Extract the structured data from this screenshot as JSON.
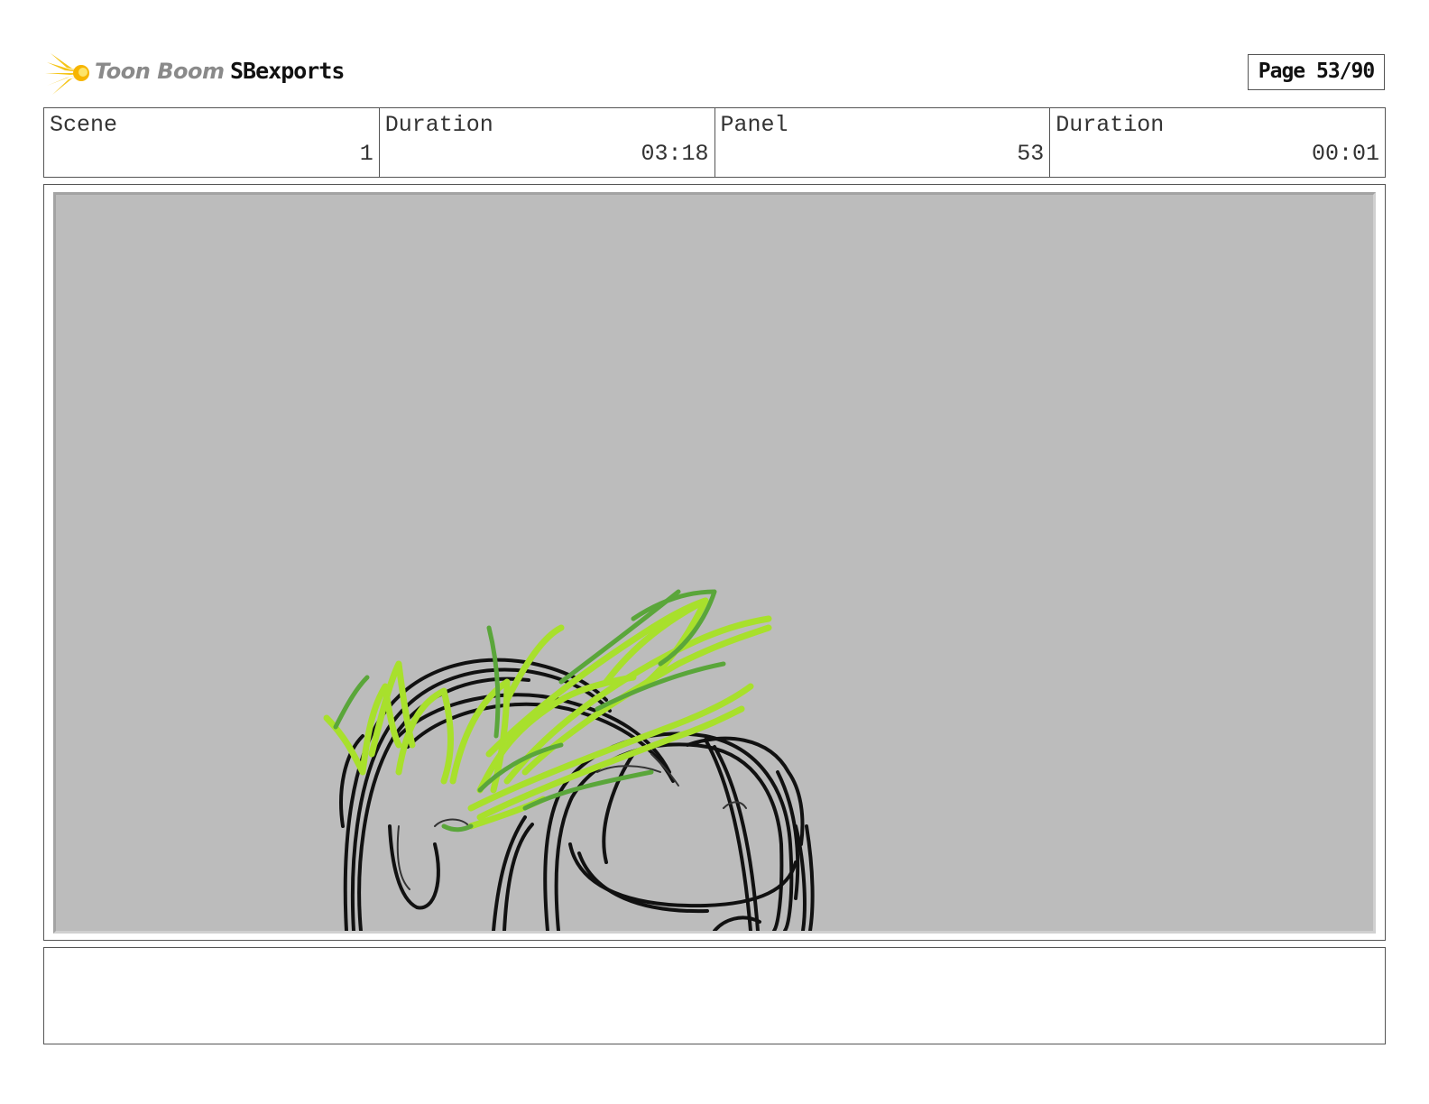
{
  "header": {
    "logo_text": "Toon Boom",
    "project_title": "SBexports",
    "page_label": "Page 53/90"
  },
  "info": {
    "scene_label": "Scene",
    "scene_value": "1",
    "scene_duration_label": "Duration",
    "scene_duration_value": "03:18",
    "panel_label": "Panel",
    "panel_value": "53",
    "panel_duration_label": "Duration",
    "panel_duration_value": "00:01"
  },
  "notes": {
    "text": ""
  },
  "colors": {
    "panel_background": "#bcbcbc",
    "sketch_line": "#111111",
    "sketch_green_light": "#a8e02c",
    "sketch_green_dark": "#5aa63a",
    "logo_yellow": "#f5c518"
  },
  "icons": {
    "logo": "toon-boom-star-burst-icon"
  }
}
